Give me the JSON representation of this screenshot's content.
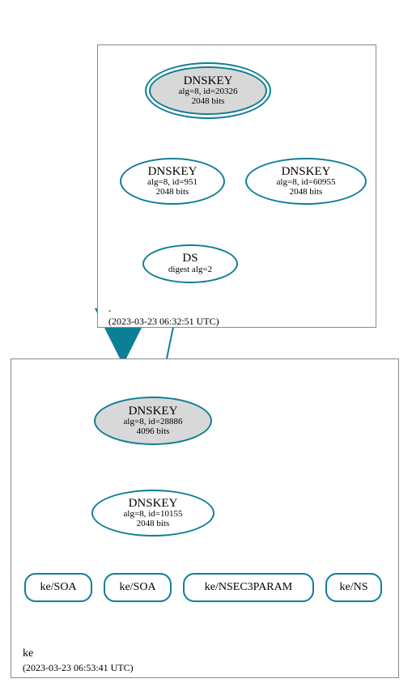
{
  "zones": {
    "root": {
      "name": ".",
      "timestamp": "(2023-03-23 06:32:51 UTC)"
    },
    "ke": {
      "name": "ke",
      "timestamp": "(2023-03-23 06:53:41 UTC)"
    }
  },
  "nodes": {
    "root_ksk": {
      "title": "DNSKEY",
      "sub1": "alg=8, id=20326",
      "sub2": "2048 bits"
    },
    "root_zsk1": {
      "title": "DNSKEY",
      "sub1": "alg=8, id=951",
      "sub2": "2048 bits"
    },
    "root_zsk2": {
      "title": "DNSKEY",
      "sub1": "alg=8, id=60955",
      "sub2": "2048 bits"
    },
    "root_ds": {
      "title": "DS",
      "sub1": "digest alg=2"
    },
    "ke_ksk": {
      "title": "DNSKEY",
      "sub1": "alg=8, id=28886",
      "sub2": "4096 bits"
    },
    "ke_zsk": {
      "title": "DNSKEY",
      "sub1": "alg=8, id=10155",
      "sub2": "2048 bits"
    },
    "ke_soa1": {
      "title": "ke/SOA"
    },
    "ke_soa2": {
      "title": "ke/SOA"
    },
    "ke_nsec3": {
      "title": "ke/NSEC3PARAM"
    },
    "ke_ns": {
      "title": "ke/NS"
    }
  },
  "chart_data": {
    "type": "graph",
    "description": "DNSSEC authentication chain",
    "zones": [
      {
        "id": "root",
        "label": ".",
        "timestamp": "2023-03-23 06:32:51 UTC"
      },
      {
        "id": "ke",
        "label": "ke",
        "timestamp": "2023-03-23 06:53:41 UTC"
      }
    ],
    "nodes": [
      {
        "id": "root_ksk",
        "zone": "root",
        "type": "DNSKEY",
        "alg": 8,
        "keyid": 20326,
        "bits": 2048,
        "role": "KSK",
        "trust_anchor": true
      },
      {
        "id": "root_zsk1",
        "zone": "root",
        "type": "DNSKEY",
        "alg": 8,
        "keyid": 951,
        "bits": 2048,
        "role": "ZSK"
      },
      {
        "id": "root_zsk2",
        "zone": "root",
        "type": "DNSKEY",
        "alg": 8,
        "keyid": 60955,
        "bits": 2048,
        "role": "ZSK"
      },
      {
        "id": "root_ds",
        "zone": "root",
        "type": "DS",
        "digest_alg": 2
      },
      {
        "id": "ke_ksk",
        "zone": "ke",
        "type": "DNSKEY",
        "alg": 8,
        "keyid": 28886,
        "bits": 4096,
        "role": "KSK"
      },
      {
        "id": "ke_zsk",
        "zone": "ke",
        "type": "DNSKEY",
        "alg": 8,
        "keyid": 10155,
        "bits": 2048,
        "role": "ZSK"
      },
      {
        "id": "ke_soa1",
        "zone": "ke",
        "type": "RRset",
        "name": "ke/SOA"
      },
      {
        "id": "ke_soa2",
        "zone": "ke",
        "type": "RRset",
        "name": "ke/SOA"
      },
      {
        "id": "ke_nsec3",
        "zone": "ke",
        "type": "RRset",
        "name": "ke/NSEC3PARAM"
      },
      {
        "id": "ke_ns",
        "zone": "ke",
        "type": "RRset",
        "name": "ke/NS"
      }
    ],
    "edges": [
      {
        "from": "root_ksk",
        "to": "root_ksk",
        "self_loop": true
      },
      {
        "from": "root_ksk",
        "to": "root_zsk1"
      },
      {
        "from": "root_ksk",
        "to": "root_zsk2"
      },
      {
        "from": "root_zsk1",
        "to": "root_ds"
      },
      {
        "from": "root_ds",
        "to": "ke_ksk"
      },
      {
        "from": "root",
        "to": "ke",
        "zone_delegation": true
      },
      {
        "from": "ke_ksk",
        "to": "ke_ksk",
        "self_loop": true
      },
      {
        "from": "ke_ksk",
        "to": "ke_zsk"
      },
      {
        "from": "ke_zsk",
        "to": "ke_soa1"
      },
      {
        "from": "ke_zsk",
        "to": "ke_soa2"
      },
      {
        "from": "ke_zsk",
        "to": "ke_nsec3"
      },
      {
        "from": "ke_zsk",
        "to": "ke_ns"
      }
    ]
  }
}
